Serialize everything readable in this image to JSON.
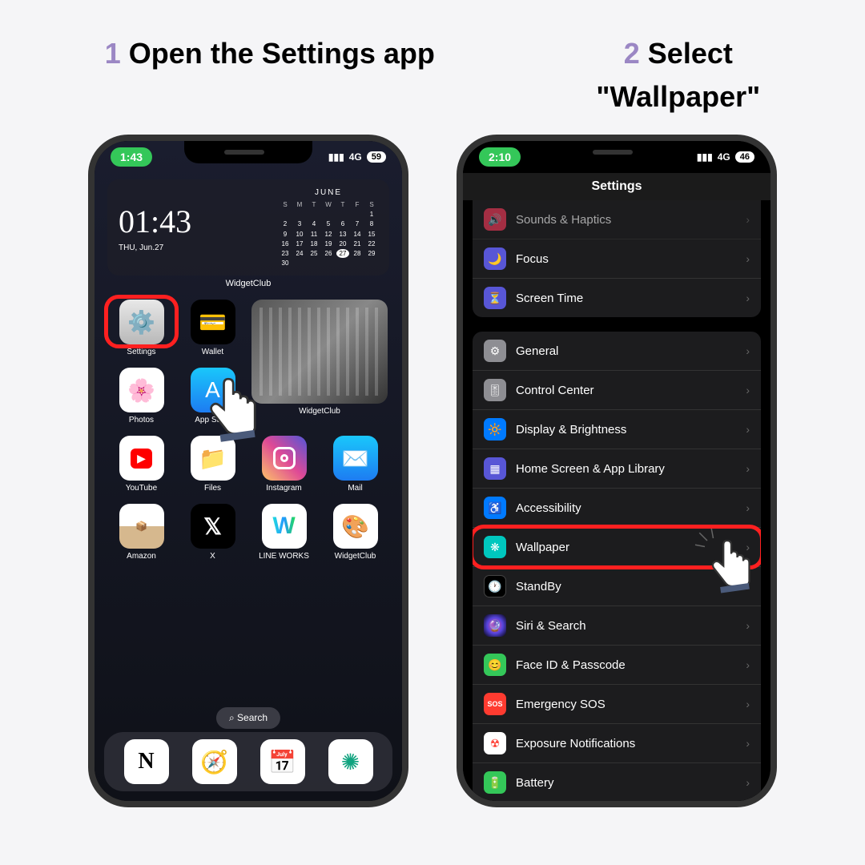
{
  "captions": {
    "c1_num": "1",
    "c1_text1": "Open",
    "c1_text2": "the Settings app",
    "c2_num": "2",
    "c2_text1": "Select",
    "c2_text2": "\"Wallpaper\""
  },
  "phone1": {
    "status_time": "1:43",
    "status_network": "4G",
    "status_battery": "59",
    "widget": {
      "time": "01:43",
      "date": "THU, Jun.27",
      "month": "JUNE",
      "label": "WidgetClub"
    },
    "apps": {
      "settings": "Settings",
      "wallet": "Wallet",
      "widgetclub_photo": "WidgetClub",
      "photos": "Photos",
      "appstore": "App Store",
      "youtube": "YouTube",
      "files": "Files",
      "instagram": "Instagram",
      "mail": "Mail",
      "amazon": "Amazon",
      "x": "X",
      "lineworks": "LINE WORKS",
      "widgetclub": "WidgetClub"
    },
    "search": "Search"
  },
  "phone2": {
    "status_time": "2:10",
    "status_network": "4G",
    "status_battery": "46",
    "title": "Settings",
    "rows": {
      "sounds": "Sounds & Haptics",
      "focus": "Focus",
      "screentime": "Screen Time",
      "general": "General",
      "controlcenter": "Control Center",
      "display": "Display & Brightness",
      "homescreen": "Home Screen & App Library",
      "accessibility": "Accessibility",
      "wallpaper": "Wallpaper",
      "standby": "StandBy",
      "siri": "Siri & Search",
      "faceid": "Face ID & Passcode",
      "sos": "Emergency SOS",
      "exposure": "Exposure Notifications",
      "battery": "Battery"
    }
  },
  "calendar_days": [
    "S",
    "M",
    "T",
    "W",
    "T",
    "F",
    "S"
  ],
  "calendar_dates": [
    "",
    "",
    "",
    "",
    "",
    "",
    "1",
    "2",
    "3",
    "4",
    "5",
    "6",
    "7",
    "8",
    "9",
    "10",
    "11",
    "12",
    "13",
    "14",
    "15",
    "16",
    "17",
    "18",
    "19",
    "20",
    "21",
    "22",
    "23",
    "24",
    "25",
    "26",
    "27",
    "28",
    "29",
    "30"
  ]
}
